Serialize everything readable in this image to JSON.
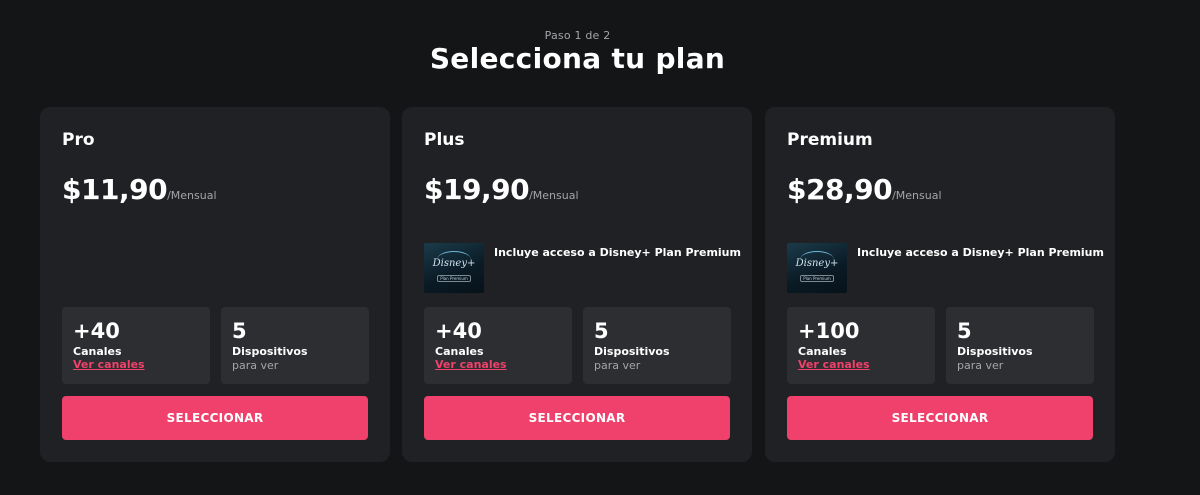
{
  "header": {
    "step": "Paso 1 de 2",
    "title": "Selecciona tu plan"
  },
  "colors": {
    "background": "#141517",
    "card": "#1f2124",
    "stat_box": "#2c2e31",
    "accent": "#ef416c",
    "muted_text": "#a3a5a8"
  },
  "plans": [
    {
      "name": "Pro",
      "price": "$11,90",
      "period": "/Mensual",
      "channels_count": "+40",
      "channels_label": "Canales",
      "channels_link": "Ver canales",
      "devices_count": "5",
      "devices_label": "Dispositivos",
      "devices_sub": "para ver",
      "button_label": "SELECCIONAR"
    },
    {
      "name": "Plus",
      "price": "$19,90",
      "period": "/Mensual",
      "addon_text": "Incluye acceso a Disney+ Plan Premium",
      "addon_logo": "Disney+",
      "addon_logo_sub": "Plan Premium",
      "addon_icon": "disney-plus-logo",
      "channels_count": "+40",
      "channels_label": "Canales",
      "channels_link": "Ver canales",
      "devices_count": "5",
      "devices_label": "Dispositivos",
      "devices_sub": "para ver",
      "button_label": "SELECCIONAR"
    },
    {
      "name": "Premium",
      "price": "$28,90",
      "period": "/Mensual",
      "addon_text": "Incluye acceso a Disney+ Plan Premium",
      "addon_logo": "Disney+",
      "addon_logo_sub": "Plan Premium",
      "addon_icon": "disney-plus-logo",
      "channels_count": "+100",
      "channels_label": "Canales",
      "channels_link": "Ver canales",
      "devices_count": "5",
      "devices_label": "Dispositivos",
      "devices_sub": "para ver",
      "button_label": "SELECCIONAR"
    }
  ]
}
